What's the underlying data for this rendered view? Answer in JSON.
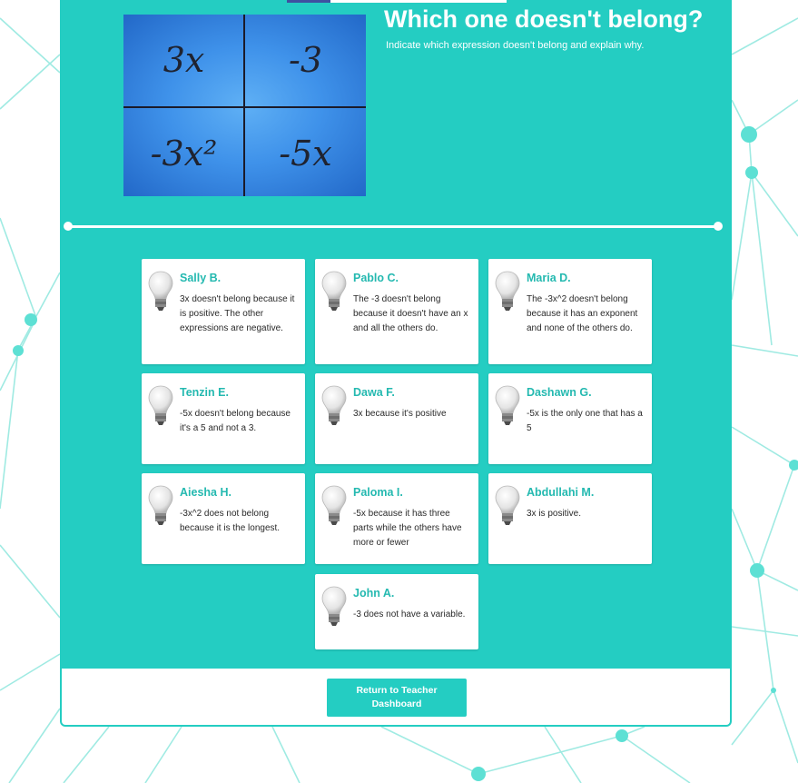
{
  "activity": {
    "title": "Which one doesn't belong?",
    "instructions": "Indicate which expression doesn't belong and explain why.",
    "expressions": [
      "3x",
      "-3",
      "-3x²",
      "-5x"
    ]
  },
  "responses": [
    {
      "name": "Sally B.",
      "text": "3x doesn't belong because it is positive. The other expressions are negative."
    },
    {
      "name": "Pablo C.",
      "text": "The -3 doesn't belong because it doesn't have an x and all the others do."
    },
    {
      "name": "Maria D.",
      "text": "The -3x^2 doesn't belong because it has an exponent and none of the others do."
    },
    {
      "name": "Tenzin E.",
      "text": "-5x doesn't belong because it's a 5 and not a 3."
    },
    {
      "name": "Dawa F.",
      "text": "3x because it's positive"
    },
    {
      "name": "Dashawn G.",
      "text": "-5x is the only one that has a 5"
    },
    {
      "name": "Aiesha H.",
      "text": "-3x^2 does not belong because it is the longest."
    },
    {
      "name": "Paloma I.",
      "text": "-5x because it has three parts while the others have more or fewer"
    },
    {
      "name": "Abdullahi M.",
      "text": "3x is positive."
    },
    {
      "name": "John A.",
      "text": "-3 does not have a variable."
    }
  ],
  "footer": {
    "return_label": "Return to Teacher Dashboard"
  },
  "icons": {
    "response": "lightbulb-icon"
  },
  "colors": {
    "accent": "#24cdc2",
    "name_text": "#24b9b0",
    "background_network": "#7fe6dc"
  }
}
